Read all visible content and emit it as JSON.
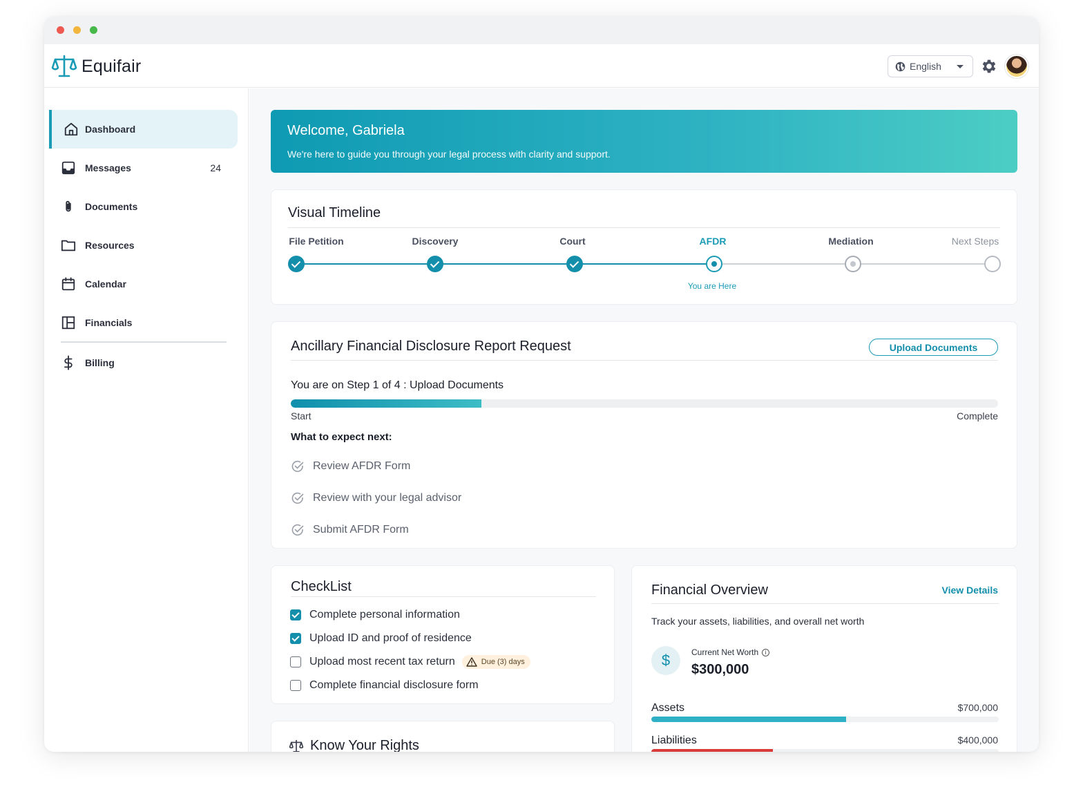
{
  "app": {
    "name": "Equifair"
  },
  "header": {
    "language": "English"
  },
  "sidebar": {
    "items": [
      {
        "label": "Dashboard",
        "icon": "home-icon",
        "active": true
      },
      {
        "label": "Messages",
        "icon": "inbox-icon",
        "count": "24"
      },
      {
        "label": "Documents",
        "icon": "paperclip-icon"
      },
      {
        "label": "Resources",
        "icon": "folder-icon"
      },
      {
        "label": "Calendar",
        "icon": "calendar-icon"
      },
      {
        "label": "Financials",
        "icon": "layout-icon"
      },
      {
        "label": "Billing",
        "icon": "dollar-icon"
      }
    ]
  },
  "welcome": {
    "title": "Welcome, Gabriela",
    "subtitle": "We're here to guide you through your legal process with clarity and support."
  },
  "timeline": {
    "title": "Visual Timeline",
    "steps": [
      {
        "label": "File Petition",
        "state": "done"
      },
      {
        "label": "Discovery",
        "state": "done"
      },
      {
        "label": "Court",
        "state": "done"
      },
      {
        "label": "AFDR",
        "state": "current"
      },
      {
        "label": "Mediation",
        "state": "next"
      },
      {
        "label": "Next Steps",
        "state": "future"
      }
    ],
    "current_note": "You are Here"
  },
  "afdr": {
    "title": "Ancillary Financial Disclosure Report Request",
    "upload_button": "Upload Documents",
    "step_text": "You are on Step 1 of 4 : Upload Documents",
    "progress": 0.27,
    "start_label": "Start",
    "complete_label": "Complete",
    "expect_title": "What to expect next:",
    "expect_items": [
      "Review AFDR Form",
      "Review with your legal advisor",
      "Submit AFDR Form"
    ]
  },
  "checklist": {
    "title": "CheckList",
    "items": [
      {
        "label": "Complete personal information",
        "checked": true
      },
      {
        "label": "Upload ID and proof of residence",
        "checked": true
      },
      {
        "label": "Upload most recent tax return",
        "checked": false,
        "badge": "Due (3) days"
      },
      {
        "label": "Complete financial disclosure form",
        "checked": false
      }
    ]
  },
  "rights": {
    "title": "Know Your Rights"
  },
  "financial": {
    "title": "Financial Overview",
    "link": "View Details",
    "description": "Track your assets, liabilities, and overall net worth",
    "net_worth_label": "Current Net Worth",
    "net_worth_value": "$300,000",
    "assets_label": "Assets",
    "assets_value": "$700,000",
    "assets_fraction": 0.56,
    "assets_color": "#2fb0c4",
    "liabilities_label": "Liabilities",
    "liabilities_value": "$400,000",
    "liabilities_fraction": 0.35,
    "liabilities_color": "#d93a3a"
  },
  "colors": {
    "accent": "#1a9bb5",
    "accent_dark": "#138fac"
  }
}
